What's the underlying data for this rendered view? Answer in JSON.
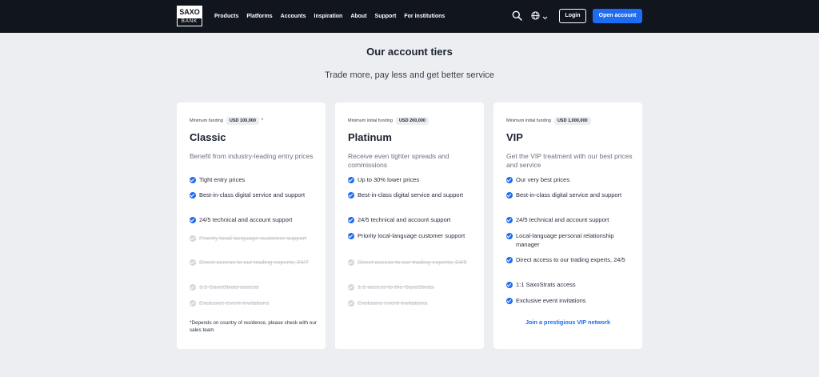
{
  "nav": {
    "logo_top": "SAXO",
    "logo_bottom": "BANK",
    "menu": [
      "Products",
      "Platforms",
      "Accounts",
      "Inspiration",
      "About",
      "Support",
      "For institutions"
    ],
    "login": "Login",
    "open_account": "Open account"
  },
  "page": {
    "title": "Our account tiers",
    "subtitle": "Trade more, pay less and get better service"
  },
  "cards": [
    {
      "funding_label": "Minimum funding",
      "amount": "USD 100,000",
      "asterisk": "*",
      "tier": "Classic",
      "description": "Benefit from industry-leading entry prices",
      "features": [
        {
          "text": "Tight entry prices",
          "enabled": true
        },
        {
          "text": "Best-in-class digital service and support",
          "enabled": true
        },
        {
          "text": "24/5 technical and account support",
          "enabled": true
        },
        {
          "text": "Priority local-language customer support",
          "enabled": false
        },
        {
          "text": "Direct access to our trading experts, 24/7",
          "enabled": false
        },
        {
          "text": "1:1 SaxoStrats access",
          "enabled": false
        },
        {
          "text": "Exclusive event invitations",
          "enabled": false
        }
      ],
      "footnote": "*Depends on country of residence, please check with our sales team"
    },
    {
      "funding_label": "Minimum initial funding",
      "amount": "USD 200,000",
      "tier": "Platinum",
      "description": "Receive even tighter spreads and commissions",
      "features": [
        {
          "text": "Up to 30% lower prices",
          "enabled": true
        },
        {
          "text": "Best-in-class digital service and support",
          "enabled": true
        },
        {
          "text": "24/5 technical and account support",
          "enabled": true
        },
        {
          "text": "Priority local-language customer support",
          "enabled": true
        },
        {
          "text": "Direct access to our trading experts, 24/5",
          "enabled": false
        },
        {
          "text": "1:1 access to the SaxoStrats",
          "enabled": false
        },
        {
          "text": "Exclusive event invitations",
          "enabled": false
        }
      ]
    },
    {
      "funding_label": "Minimum initial funding",
      "amount": "USD 1,000,000",
      "tier": "VIP",
      "description": "Get the VIP treatment with our best prices and service",
      "features": [
        {
          "text": "Our very best prices",
          "enabled": true
        },
        {
          "text": "Best-in-class digital service and support",
          "enabled": true
        },
        {
          "text": "24/5 technical and account support",
          "enabled": true
        },
        {
          "text": "Local-language personal relationship manager",
          "enabled": true
        },
        {
          "text": "Direct access to our trading experts, 24/5",
          "enabled": true
        },
        {
          "text": "1:1 SaxoStrats access",
          "enabled": true
        },
        {
          "text": "Exclusive event invitations",
          "enabled": true
        }
      ],
      "link": "Join a prestigious VIP network"
    }
  ],
  "icons": {
    "search": "search-icon",
    "globe": "globe-icon",
    "chevron": "chevron-down-icon",
    "check": "check-circle-icon"
  },
  "colors": {
    "accent": "#1d6cf2",
    "nav_bg": "#11151d",
    "page_bg": "#eceef1"
  }
}
